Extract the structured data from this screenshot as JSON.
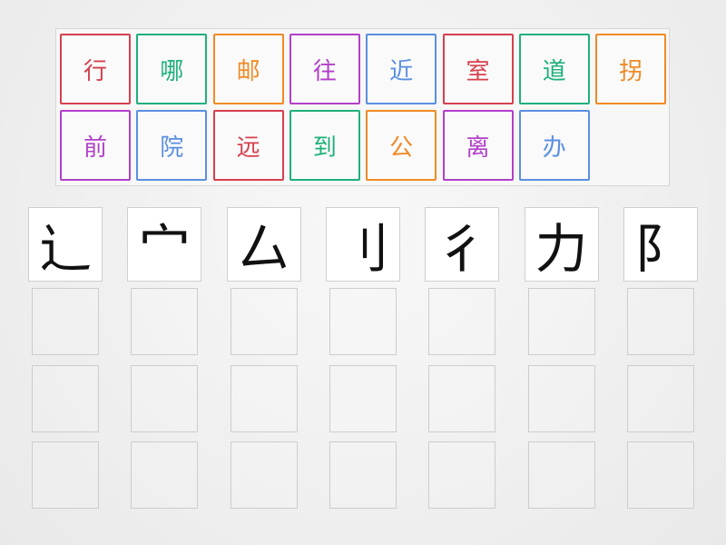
{
  "tiles": [
    {
      "char": "行",
      "color": "#d6404e"
    },
    {
      "char": "哪",
      "color": "#1fb07a"
    },
    {
      "char": "邮",
      "color": "#f08a24"
    },
    {
      "char": "往",
      "color": "#b23fc9"
    },
    {
      "char": "近",
      "color": "#5a8fe0"
    },
    {
      "char": "室",
      "color": "#d6404e"
    },
    {
      "char": "道",
      "color": "#1fb07a"
    },
    {
      "char": "拐",
      "color": "#f08a24"
    },
    {
      "char": "前",
      "color": "#b23fc9"
    },
    {
      "char": "院",
      "color": "#5a8fe0"
    },
    {
      "char": "远",
      "color": "#d6404e"
    },
    {
      "char": "到",
      "color": "#1fb07a"
    },
    {
      "char": "公",
      "color": "#f08a24"
    },
    {
      "char": "离",
      "color": "#b23fc9"
    },
    {
      "char": "办",
      "color": "#5a8fe0"
    }
  ],
  "radicals": [
    "辶",
    "宀",
    "厶",
    "刂",
    "彳",
    "力",
    "阝"
  ],
  "slots_per_column": 3
}
